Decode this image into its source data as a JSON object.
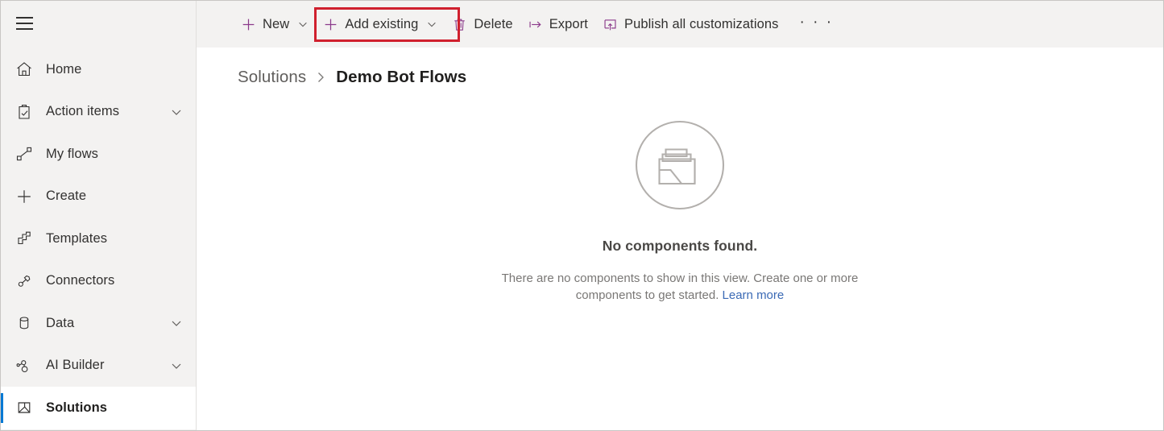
{
  "sidebar": {
    "menu_toggle": "hamburger-menu-icon",
    "items": [
      {
        "label": "Home",
        "icon": "home-icon",
        "expandable": false,
        "selected": false
      },
      {
        "label": "Action items",
        "icon": "clipboard-check-icon",
        "expandable": true,
        "selected": false
      },
      {
        "label": "My flows",
        "icon": "flow-icon",
        "expandable": false,
        "selected": false
      },
      {
        "label": "Create",
        "icon": "plus-icon",
        "expandable": false,
        "selected": false
      },
      {
        "label": "Templates",
        "icon": "templates-icon",
        "expandable": false,
        "selected": false
      },
      {
        "label": "Connectors",
        "icon": "connectors-icon",
        "expandable": false,
        "selected": false
      },
      {
        "label": "Data",
        "icon": "database-icon",
        "expandable": true,
        "selected": false
      },
      {
        "label": "AI Builder",
        "icon": "ai-builder-icon",
        "expandable": true,
        "selected": false
      },
      {
        "label": "Solutions",
        "icon": "solutions-icon",
        "expandable": false,
        "selected": true
      }
    ]
  },
  "command_bar": {
    "commands": [
      {
        "label": "New",
        "icon": "plus-icon",
        "has_chevron": true
      },
      {
        "label": "Add existing",
        "icon": "plus-icon",
        "has_chevron": true
      },
      {
        "label": "Delete",
        "icon": "trash-icon",
        "has_chevron": false
      },
      {
        "label": "Export",
        "icon": "export-icon",
        "has_chevron": false
      },
      {
        "label": "Publish all customizations",
        "icon": "publish-icon",
        "has_chevron": false
      }
    ],
    "overflow_label": "· · ·",
    "highlighted_command": "Add existing",
    "highlight_color": "#d0202e"
  },
  "breadcrumb": {
    "parent": "Solutions",
    "separator": "›",
    "current": "Demo Bot Flows"
  },
  "empty_state": {
    "illustration": "empty-folder-illustration",
    "title": "No components found.",
    "description": "There are no components to show in this view. Create one or more components to get started. ",
    "link_text": "Learn more"
  },
  "colors": {
    "accent_purple": "#8b3a8b",
    "selection_blue": "#0078d4",
    "link_blue": "#3b6ab5",
    "sidebar_bg": "#f3f2f1",
    "command_bar_bg": "#f3f2f1"
  }
}
